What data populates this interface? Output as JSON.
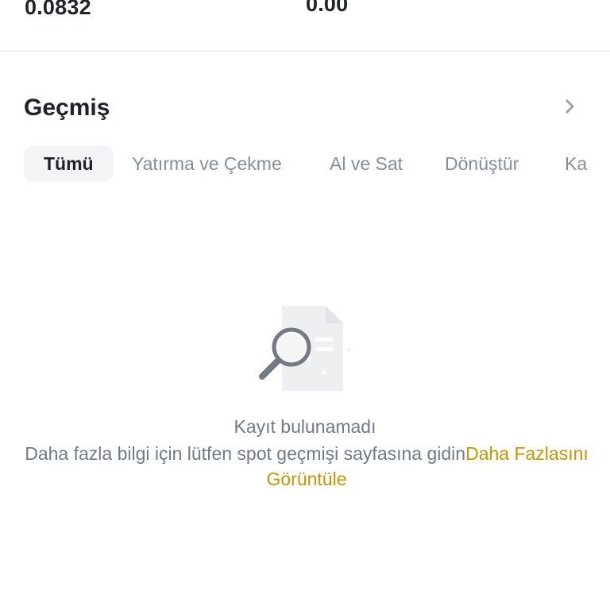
{
  "balances": {
    "left_value": "0.0832",
    "right_value": "0.00"
  },
  "history": {
    "title": "Geçmiş",
    "more_icon": "chevron-right-icon",
    "tabs": [
      {
        "label": "Tümü",
        "active": true
      },
      {
        "label": "Yatırma ve Çekme",
        "active": false
      },
      {
        "label": "Al ve Sat",
        "active": false
      },
      {
        "label": "Dönüştür",
        "active": false
      },
      {
        "label": "Ka",
        "active": false
      }
    ]
  },
  "empty_state": {
    "icon": "no-records-search-icon",
    "title": "Kayıt bulunamadı",
    "description": "Daha fazla bilgi için lütfen spot geçmişi sayfasına gidin",
    "link_label": "Daha Fazlasını Görüntüle"
  },
  "colors": {
    "text_primary": "#1e2329",
    "text_secondary": "#848e9c",
    "link": "#c99400",
    "active_tab_bg": "#f3f4f6"
  }
}
